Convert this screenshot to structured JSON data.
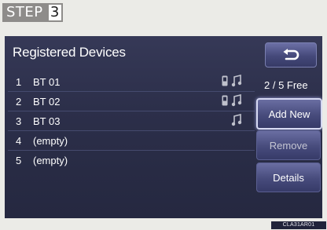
{
  "step": {
    "label": "STEP",
    "number": "3"
  },
  "screen": {
    "title": "Registered Devices",
    "back_icon": "back-arrow-icon",
    "devices": [
      {
        "num": "1",
        "name": "BT 01",
        "phone": true,
        "music": true
      },
      {
        "num": "2",
        "name": "BT 02",
        "phone": true,
        "music": true
      },
      {
        "num": "3",
        "name": "BT 03",
        "phone": false,
        "music": true
      },
      {
        "num": "4",
        "name": "(empty)",
        "phone": false,
        "music": false
      },
      {
        "num": "5",
        "name": "(empty)",
        "phone": false,
        "music": false
      }
    ],
    "free": "2 / 5 Free",
    "buttons": {
      "add_new": "Add New",
      "remove": "Remove",
      "details": "Details"
    }
  },
  "image_code": "CLA31AR01",
  "colors": {
    "page_bg": "#ebebe7",
    "screen_bg": "#2c2f4a",
    "button": "#474b7c",
    "icon_gray": "#bfc1cc"
  }
}
